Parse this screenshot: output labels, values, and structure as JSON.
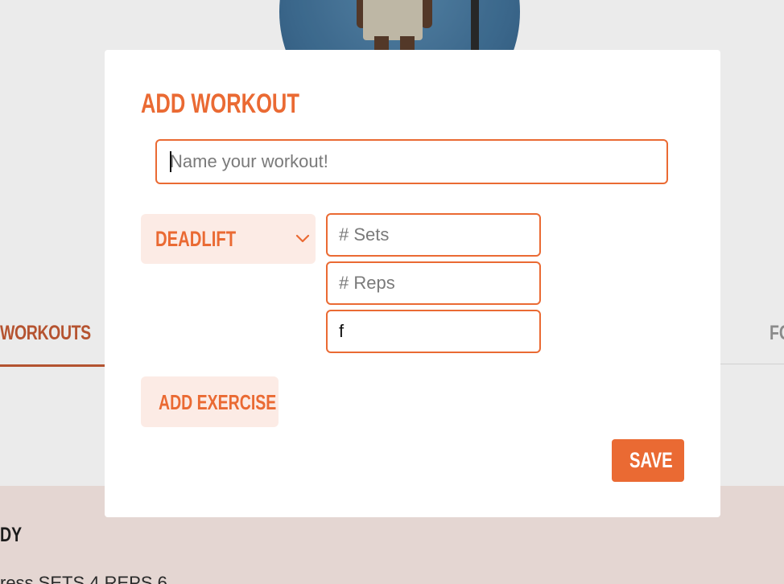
{
  "background": {
    "active_tab": "WORKOUTS",
    "right_tab_partial": "FO",
    "section_title_partial": "DY",
    "exercise_line_partial": "ress SETS 4 REPS 6"
  },
  "modal": {
    "title": "ADD WORKOUT",
    "name_input": {
      "placeholder": "Name your workout!",
      "value": ""
    },
    "exercise_select": {
      "selected": "DEADLIFT"
    },
    "sets_input": {
      "placeholder": "# Sets",
      "value": ""
    },
    "reps_input": {
      "placeholder": "# Reps",
      "value": ""
    },
    "third_input": {
      "value": "f"
    },
    "add_exercise_label": "ADD EXERCISE",
    "save_label": "SAVE"
  },
  "colors": {
    "accent": "#ea6a33",
    "accent_light": "#fcebe5",
    "overlay_dim": "#ebebeb"
  }
}
